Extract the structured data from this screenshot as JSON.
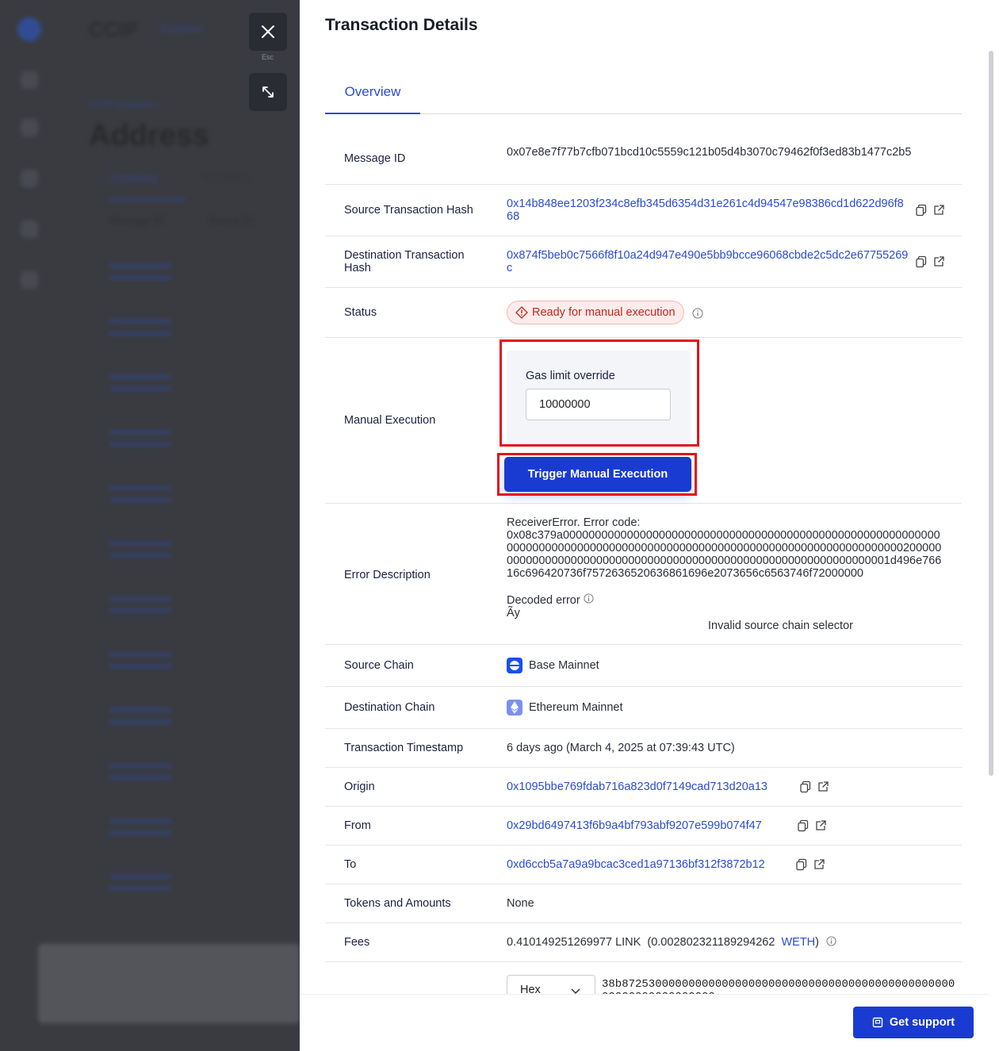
{
  "background": {
    "brand": "CCIP",
    "nav_item": "Explorer",
    "breadcrumb": "CCIP Explorer /",
    "page_title": "Address",
    "tab_outgoing": "Outgoing",
    "tab_incoming": "Incoming",
    "col_message_id": "Message ID",
    "col_source_tx": "Source Tx"
  },
  "overlay": {
    "close_label": "Esc"
  },
  "panel": {
    "title": "Transaction Details",
    "tab_overview": "Overview"
  },
  "details": {
    "message_id": {
      "label": "Message ID",
      "value": "0x07e8e7f77b7cfb071bcd10c5559c121b05d4b3070c79462f0f3ed83b1477c2b5"
    },
    "source_tx_hash": {
      "label": "Source Transaction Hash",
      "value": "0x14b848ee1203f234c8efb345d6354d31e261c4d94547e98386cd1d622d96f868"
    },
    "dest_tx_hash": {
      "label": "Destination Transaction Hash",
      "value": "0x874f5beb0c7566f8f10a24d947e490e5bb9bcce96068cbde2c5dc2e67755269c"
    },
    "status": {
      "label": "Status",
      "value": "Ready for manual execution"
    },
    "manual_execution": {
      "label": "Manual Execution",
      "gas_label": "Gas limit override",
      "gas_value": "10000000",
      "button": "Trigger Manual Execution"
    },
    "error": {
      "label": "Error Description",
      "prefix": "ReceiverError. Error code:",
      "code": "0x08c379a0000000000000000000000000000000000000000000000000000000000000000000000000000000000000000000000000000000000000000000000000200000000000000000000000000000000000000000000000000000000000000001d496e76616c696420736f7572636520636861696e2073656c6563746f72000000",
      "decoded_label": "Decoded error",
      "decoded_garbage": "Ãy",
      "decoded_message": "Invalid source chain selector"
    },
    "source_chain": {
      "label": "Source Chain",
      "value": "Base Mainnet"
    },
    "dest_chain": {
      "label": "Destination Chain",
      "value": "Ethereum Mainnet"
    },
    "timestamp": {
      "label": "Transaction Timestamp",
      "value": "6 days ago (March 4, 2025 at 07:39:43 UTC)"
    },
    "origin": {
      "label": "Origin",
      "value": "0x1095bbe769fdab716a823d0f7149cad713d20a13"
    },
    "from": {
      "label": "From",
      "value": "0x29bd6497413f6b9a4bf793abf9207e599b074f47"
    },
    "to": {
      "label": "To",
      "value": "0xd6ccb5a7a9a9bcac3ced1a97136bf312f3872b12"
    },
    "tokens": {
      "label": "Tokens and Amounts",
      "value": "None"
    },
    "fees": {
      "label": "Fees",
      "amount": "0.410149251269977 LINK",
      "open": "(0.002802321189294262",
      "token": "WETH",
      "close": ")"
    },
    "data": {
      "format": "Hex",
      "value": "38b8725300000000000000000000000000000000000000000000000000000000000000"
    }
  },
  "support_button": "Get support",
  "colors": {
    "accent": "#1a3bd1",
    "link": "#2a4bd7",
    "status_red": "#c0281d",
    "highlight": "#e3111b"
  }
}
